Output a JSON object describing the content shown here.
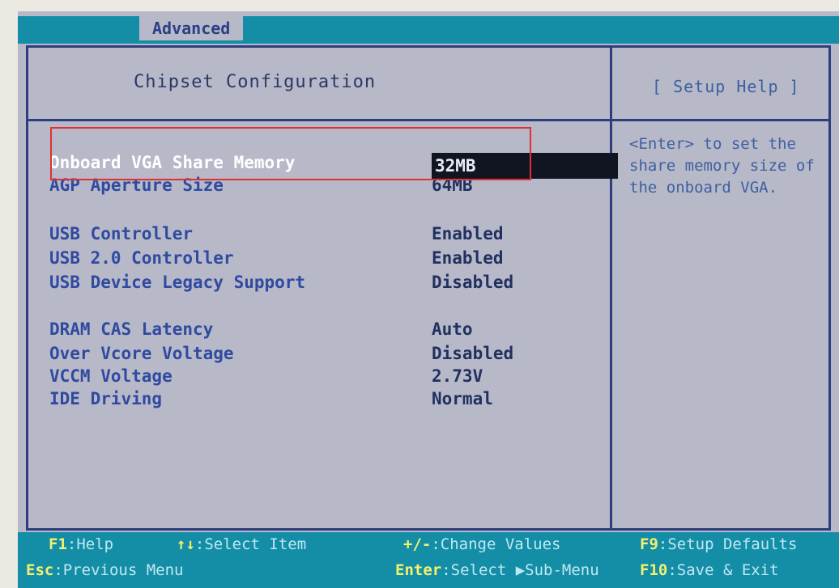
{
  "top_tab": {
    "label": "Advanced"
  },
  "panel": {
    "title": "Chipset Configuration",
    "help_title": "[ Setup Help ]"
  },
  "settings": [
    {
      "label": "Onboard VGA Share Memory",
      "value": "32MB"
    },
    {
      "label": "AGP Aperture Size",
      "value": "64MB"
    },
    {
      "label": "USB Controller",
      "value": "Enabled"
    },
    {
      "label": "USB 2.0 Controller",
      "value": "Enabled"
    },
    {
      "label": "USB Device Legacy Support",
      "value": "Disabled"
    },
    {
      "label": "DRAM CAS Latency",
      "value": "Auto"
    },
    {
      "label": "Over Vcore Voltage",
      "value": "Disabled"
    },
    {
      "label": "VCCM Voltage",
      "value": "2.73V"
    },
    {
      "label": "IDE Driving",
      "value": "Normal"
    }
  ],
  "help_text": "<Enter> to set the share memory size of the onboard VGA.",
  "footer": {
    "f1": {
      "key": "F1",
      "desc": ":Help"
    },
    "select_item": {
      "key": "↑↓",
      "desc": ":Select Item"
    },
    "change_values": {
      "key": "+/-",
      "desc": ":Change Values"
    },
    "f9": {
      "key": "F9",
      "desc": ":Setup Defaults"
    },
    "esc": {
      "key": "Esc",
      "desc": ":Previous Menu"
    },
    "enter": {
      "key": "Enter",
      "desc": ":Select ▶Sub-Menu"
    },
    "f10": {
      "key": "F10",
      "desc": ":Save & Exit"
    }
  },
  "colors": {
    "background": "#b7b9c8",
    "bar": "#148ea6",
    "label": "#2f4aa0",
    "key": "#f4f070",
    "highlight_box": "#e03030"
  }
}
